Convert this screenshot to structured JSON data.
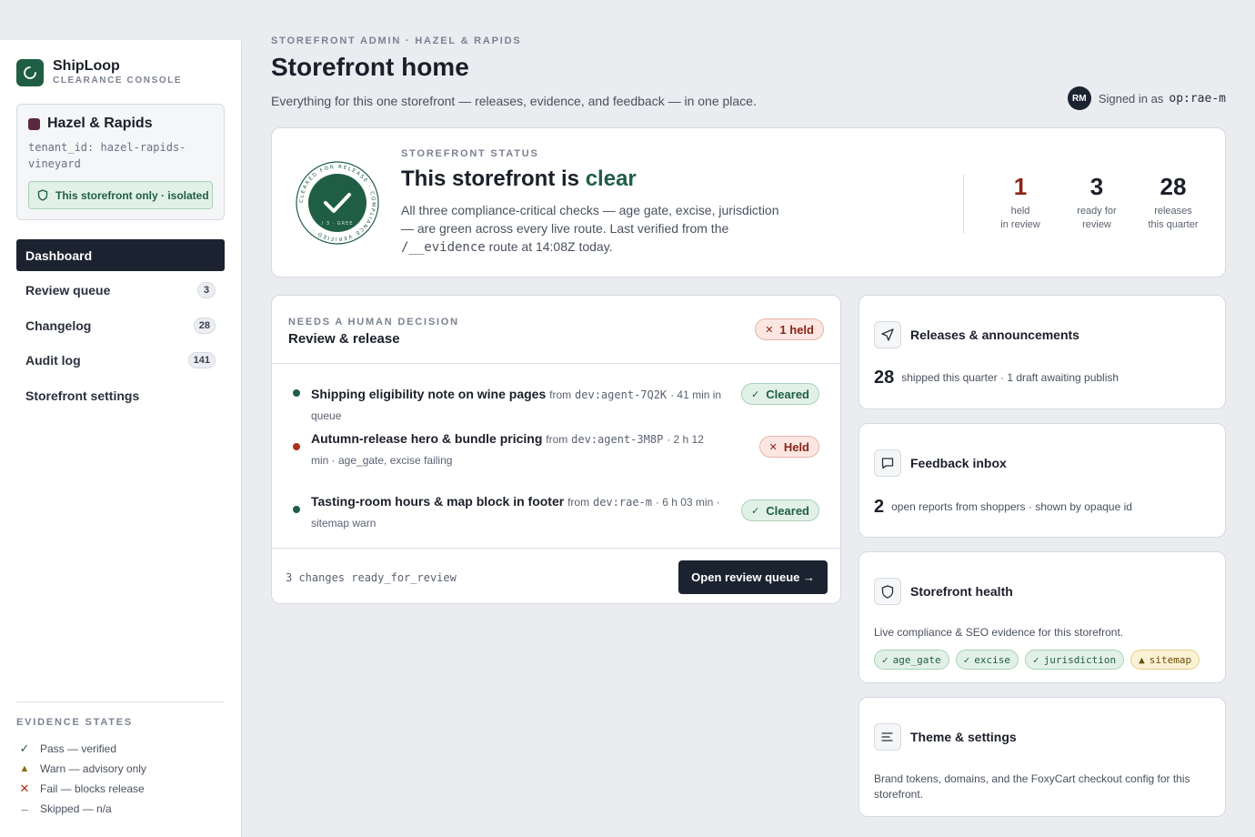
{
  "brand": {
    "name": "ShipLoop",
    "sub": "CLEARANCE CONSOLE"
  },
  "tenant": {
    "name": "Hazel & Rapids",
    "id_label": "tenant_id: hazel-rapids-vineyard",
    "isolated": "This storefront only · isolated",
    "swatch_color": "#5a2840"
  },
  "nav": [
    {
      "label": "Dashboard",
      "count": "",
      "active": true
    },
    {
      "label": "Review queue",
      "count": "3"
    },
    {
      "label": "Changelog",
      "count": "28"
    },
    {
      "label": "Audit log",
      "count": "141"
    },
    {
      "label": "Storefront settings",
      "count": ""
    }
  ],
  "legend": {
    "title": "EVIDENCE STATES",
    "items": [
      {
        "glyph": "✓",
        "label": "Pass — verified",
        "color": "#1f5e45"
      },
      {
        "glyph": "▲",
        "label": "Warn — advisory only",
        "color": "#8a6a12"
      },
      {
        "glyph": "✕",
        "label": "Fail — blocks release",
        "color": "#a8321f"
      },
      {
        "glyph": "–",
        "label": "Skipped — n/a",
        "color": "#7b8290"
      }
    ]
  },
  "header": {
    "crumb": "STOREFRONT ADMIN · HAZEL & RAPIDS",
    "title": "Storefront home",
    "subtitle": "Everything for this one storefront — releases, evidence, and feedback — in one place.",
    "avatar": "RM",
    "signed_in": "Signed in as",
    "user": "op:rae-m"
  },
  "status": {
    "eyebrow": "STOREFRONT STATUS",
    "headline_prefix": "This storefront is",
    "headline_state": "clear",
    "desc_1": "All three compliance-critical checks — age gate, excise, jurisdiction — are green across every live route. Last verified from the",
    "desc_route": "/__evidence",
    "desc_2": "route at 14:08Z today.",
    "seal_ring_text": "CLEARED FOR RELEASE · COMPLIANCE VERIFIED ·",
    "seal_inner": "/ 3 · GREE",
    "stats": [
      {
        "num": "1",
        "label_1": "held",
        "label_2": "in review",
        "held": true
      },
      {
        "num": "3",
        "label_1": "ready for",
        "label_2": "review"
      },
      {
        "num": "28",
        "label_1": "releases",
        "label_2": "this quarter"
      }
    ]
  },
  "review": {
    "eyebrow": "NEEDS A HUMAN DECISION",
    "title": "Review & release",
    "held_pill": "1 held",
    "rows": [
      {
        "title": "Shipping eligibility note on wine pages",
        "from": "from",
        "agent": "dev:agent-7Q2K",
        "meta": "· 41 min in queue",
        "state": "Cleared"
      },
      {
        "title": "Autumn-release hero & bundle pricing",
        "from": "from",
        "agent": "dev:agent-3M8P",
        "meta": "· 2 h 12 min · age_gate, excise failing",
        "state": "Held"
      },
      {
        "title": "Tasting-room hours & map block in footer",
        "from": "from",
        "agent": "dev:rae-m",
        "meta": "· 6 h 03 min · sitemap warn",
        "state": "Cleared"
      }
    ],
    "footer": "3 changes ready_for_review",
    "button": "Open review queue →"
  },
  "cards": {
    "releases": {
      "title": "Releases & announcements",
      "num": "28",
      "text": "shipped this quarter · 1 draft awaiting publish"
    },
    "feedback": {
      "title": "Feedback inbox",
      "num": "2",
      "text": "open reports from shoppers · shown by opaque id"
    },
    "health": {
      "title": "Storefront health",
      "text": "Live compliance & SEO evidence for this storefront.",
      "chips": [
        {
          "glyph": "✓",
          "label": "age_gate",
          "kind": "ok"
        },
        {
          "glyph": "✓",
          "label": "excise",
          "kind": "ok"
        },
        {
          "glyph": "✓",
          "label": "jurisdiction",
          "kind": "ok"
        },
        {
          "glyph": "▲",
          "label": "sitemap",
          "kind": "warn"
        }
      ]
    },
    "theme": {
      "title": "Theme & settings",
      "text": "Brand tokens, domains, and the FoxyCart checkout config for this storefront."
    }
  },
  "colors": {
    "accent_green": "#1f5e45",
    "held_red": "#8a2418",
    "navy": "#1b2230"
  }
}
